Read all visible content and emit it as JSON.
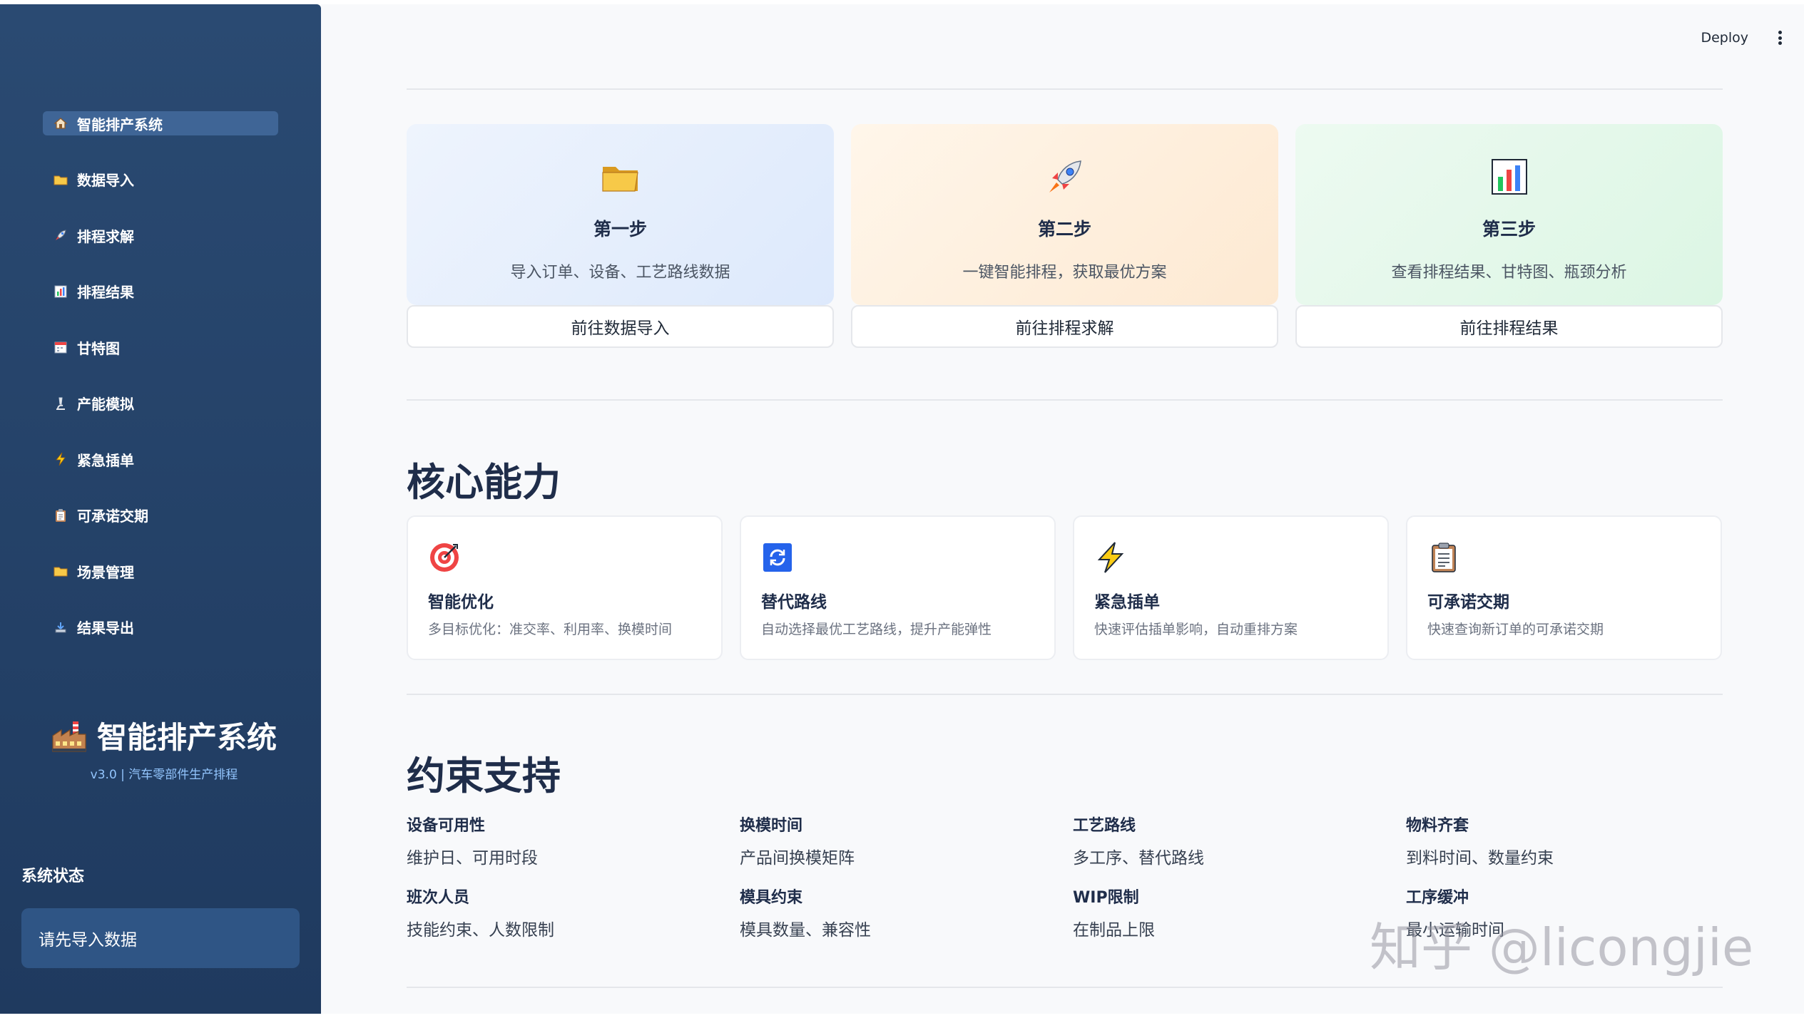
{
  "sidebar": {
    "items": [
      {
        "label": "智能排产系统",
        "icon": "home-icon"
      },
      {
        "label": "数据导入",
        "icon": "folder-icon"
      },
      {
        "label": "排程求解",
        "icon": "rocket-icon"
      },
      {
        "label": "排程结果",
        "icon": "bar-chart-icon"
      },
      {
        "label": "甘特图",
        "icon": "calendar-icon"
      },
      {
        "label": "产能模拟",
        "icon": "microscope-icon"
      },
      {
        "label": "紧急插单",
        "icon": "lightning-icon"
      },
      {
        "label": "可承诺交期",
        "icon": "clipboard-icon"
      },
      {
        "label": "场景管理",
        "icon": "folder-icon"
      },
      {
        "label": "结果导出",
        "icon": "download-tray-icon"
      }
    ],
    "brand_title": "智能排产系统",
    "brand_subtitle": "v3.0 | 汽车零部件生产排程",
    "status_title": "系统状态",
    "status_message": "请先导入数据"
  },
  "header": {
    "deploy_label": "Deploy"
  },
  "steps": [
    {
      "title": "第一步",
      "desc": "导入订单、设备、工艺路线数据",
      "button": "前往数据导入",
      "icon": "folder-icon",
      "bg": "#e4eefd"
    },
    {
      "title": "第二步",
      "desc": "一键智能排程，获取最优方案",
      "button": "前往排程求解",
      "icon": "rocket-icon",
      "bg": "#fdeedc"
    },
    {
      "title": "第三步",
      "desc": "查看排程结果、甘特图、瓶颈分析",
      "button": "前往排程结果",
      "icon": "bar-chart-icon",
      "bg": "#e3f8e9"
    }
  ],
  "capabilities": {
    "title": "核心能力",
    "items": [
      {
        "title": "智能优化",
        "desc": "多目标优化：准交率、利用率、换模时间",
        "icon": "target-icon"
      },
      {
        "title": "替代路线",
        "desc": "自动选择最优工艺路线，提升产能弹性",
        "icon": "refresh-icon"
      },
      {
        "title": "紧急插单",
        "desc": "快速评估插单影响，自动重排方案",
        "icon": "lightning-icon"
      },
      {
        "title": "可承诺交期",
        "desc": "快速查询新订单的可承诺交期",
        "icon": "clipboard-icon"
      }
    ]
  },
  "constraints": {
    "title": "约束支持",
    "items": [
      {
        "title": "设备可用性",
        "desc": "维护日、可用时段"
      },
      {
        "title": "换模时间",
        "desc": "产品间换模矩阵"
      },
      {
        "title": "工艺路线",
        "desc": "多工序、替代路线"
      },
      {
        "title": "物料齐套",
        "desc": "到料时间、数量约束"
      },
      {
        "title": "班次人员",
        "desc": "技能约束、人数限制"
      },
      {
        "title": "模具约束",
        "desc": "模具数量、兼容性"
      },
      {
        "title": "WIP限制",
        "desc": "在制品上限"
      },
      {
        "title": "工序缓冲",
        "desc": "最小运输时间"
      }
    ]
  },
  "watermark": "知乎 @licongjie"
}
